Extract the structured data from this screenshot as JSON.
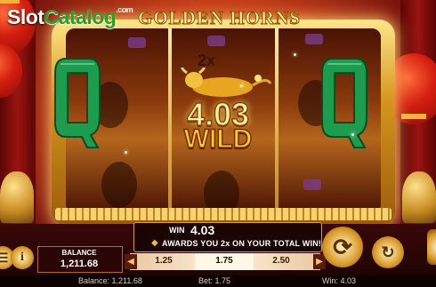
{
  "watermark": {
    "slot": "Slot",
    "catalog": "Catalog",
    "com": ".com"
  },
  "game": {
    "title": "GOLDEN HORNS"
  },
  "feature": {
    "multiplier": "2x",
    "win_amount": "4.03",
    "wild_label": "WILD"
  },
  "reels": {
    "left_symbol": "Q",
    "right_symbol": "Q"
  },
  "win_panel": {
    "label": "WIN",
    "value": "4.03",
    "message": "AWARDS YOU 2x ON YOUR TOTAL WIN!"
  },
  "bet_options": [
    {
      "label": "1.25",
      "selected": false
    },
    {
      "label": "1.75",
      "selected": true
    },
    {
      "label": "2.50",
      "selected": false
    }
  ],
  "balance_box": {
    "label": "BALANCE",
    "value": "1,211.68"
  },
  "status_bar": {
    "balance": "Balance: 1,211.68",
    "bet": "Bet: 1.75",
    "win": "Win: 4.03"
  },
  "icons": {
    "menu": "menu-icon",
    "info": "info-icon",
    "spin": "spin-arrows-icon",
    "autoplay": "autoplay-icon",
    "bet_prev": "chevron-left-icon",
    "bet_next": "chevron-right-icon"
  },
  "colors": {
    "jade": "#1e9c4e",
    "gold": "#f3c66a",
    "wild": "#ffcf3a"
  }
}
